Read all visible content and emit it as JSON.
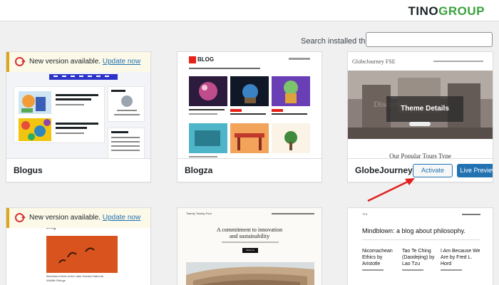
{
  "brand": {
    "logo_main": "TINO",
    "logo_accent": "GROUP"
  },
  "search": {
    "label": "Search installed themes",
    "value": "",
    "placeholder": ""
  },
  "themes": [
    {
      "name": "Blogus",
      "update_text": "New version available.",
      "update_link": "Update now"
    },
    {
      "name": "Blogza",
      "preview": {
        "logo": "BLOG"
      }
    },
    {
      "name": "GlobeJourney FSE",
      "preview": {
        "site_title": "GlobeJourney FSE",
        "hero_text": "Discover",
        "section_title": "Our Popular Tours Type"
      },
      "details_label": "Theme Details",
      "activate_label": "Activate",
      "live_preview_label": "Live Preview"
    },
    {
      "name": "",
      "update_text": "New version available.",
      "update_link": "Update now",
      "preview": {
        "heading": "blog",
        "caption_line1": "Marshland birds at the Lake Havasu National",
        "caption_line2": "Wildlife Refuge"
      }
    },
    {
      "name": "",
      "preview": {
        "site_name": "Twenty Twenty-Four",
        "headline_line1": "A commitment to innovation",
        "headline_line2": "and sustainability",
        "cta": "About us"
      }
    },
    {
      "name": "",
      "preview": {
        "site_name": "TT4",
        "tagline": "Mindblown: a blog about philosophy.",
        "post1_line1": "Nicomachean",
        "post1_line2": "Ethics by",
        "post1_line3": "Aristotle",
        "post2_line1": "Tao Te Ching",
        "post2_line2": "(Daodejing) by",
        "post2_line3": "Lao Tzu",
        "post3_line1": "I Am Because We",
        "post3_line2": "Are by Fred L.",
        "post3_line3": "Hord"
      }
    }
  ],
  "colors": {
    "primary": "#2271b1",
    "notice_border": "#dba617",
    "arrow": "#e02020",
    "brand_green": "#3aa23c"
  }
}
